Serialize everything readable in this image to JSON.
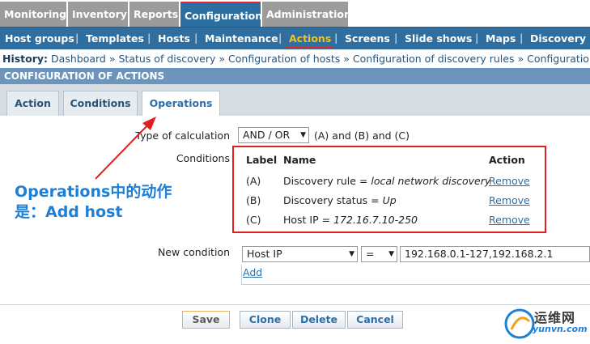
{
  "top_menu": [
    {
      "label": "Monitoring",
      "active": false
    },
    {
      "label": "Inventory",
      "active": false
    },
    {
      "label": "Reports",
      "active": false
    },
    {
      "label": "Configuration",
      "active": true
    },
    {
      "label": "Administration",
      "active": false
    }
  ],
  "sub_menu": [
    {
      "label": "Host groups",
      "active": false
    },
    {
      "label": "Templates",
      "active": false
    },
    {
      "label": "Hosts",
      "active": false
    },
    {
      "label": "Maintenance",
      "active": false
    },
    {
      "label": "Actions",
      "active": true
    },
    {
      "label": "Screens",
      "active": false
    },
    {
      "label": "Slide shows",
      "active": false
    },
    {
      "label": "Maps",
      "active": false
    },
    {
      "label": "Discovery",
      "active": false
    }
  ],
  "history": {
    "label": "History:",
    "items": [
      "Dashboard",
      "Status of discovery",
      "Configuration of hosts",
      "Configuration of discovery rules",
      "Configuration of actions"
    ],
    "separator": "»"
  },
  "page_header": "CONFIGURATION OF ACTIONS",
  "form_tabs": [
    {
      "label": "Action",
      "active": false
    },
    {
      "label": "Conditions",
      "active": false
    },
    {
      "label": "Operations",
      "active": true
    }
  ],
  "calculation": {
    "label": "Type of calculation",
    "selected": "AND / OR",
    "formula": "(A) and (B) and (C)"
  },
  "conditions": {
    "label": "Conditions",
    "headers": {
      "label": "Label",
      "name": "Name",
      "action": "Action"
    },
    "rows": [
      {
        "label": "(A)",
        "name_prefix": "Discovery rule = ",
        "name_value": "local network discovery",
        "action": "Remove"
      },
      {
        "label": "(B)",
        "name_prefix": "Discovery status = ",
        "name_value": "Up",
        "action": "Remove"
      },
      {
        "label": "(C)",
        "name_prefix": "Host IP = ",
        "name_value": "172.16.7.10-250",
        "action": "Remove"
      }
    ]
  },
  "new_condition": {
    "label": "New condition",
    "type_selected": "Host IP",
    "operator_selected": "=",
    "value": "192.168.0.1-127,192.168.2.1",
    "add_label": "Add"
  },
  "annotation": {
    "line1": "Operations中的动作",
    "line2": "是：Add host",
    "color": "#1e7fd6"
  },
  "buttons": {
    "save": "Save",
    "clone": "Clone",
    "delete": "Delete",
    "cancel": "Cancel"
  },
  "watermark": {
    "line1": "运维网",
    "line2": "yunvn.com"
  },
  "colors": {
    "accent": "#2f6e9e",
    "active_submenu": "#f4c21c",
    "highlight_red": "#e02020",
    "link": "#2c6fa8"
  }
}
